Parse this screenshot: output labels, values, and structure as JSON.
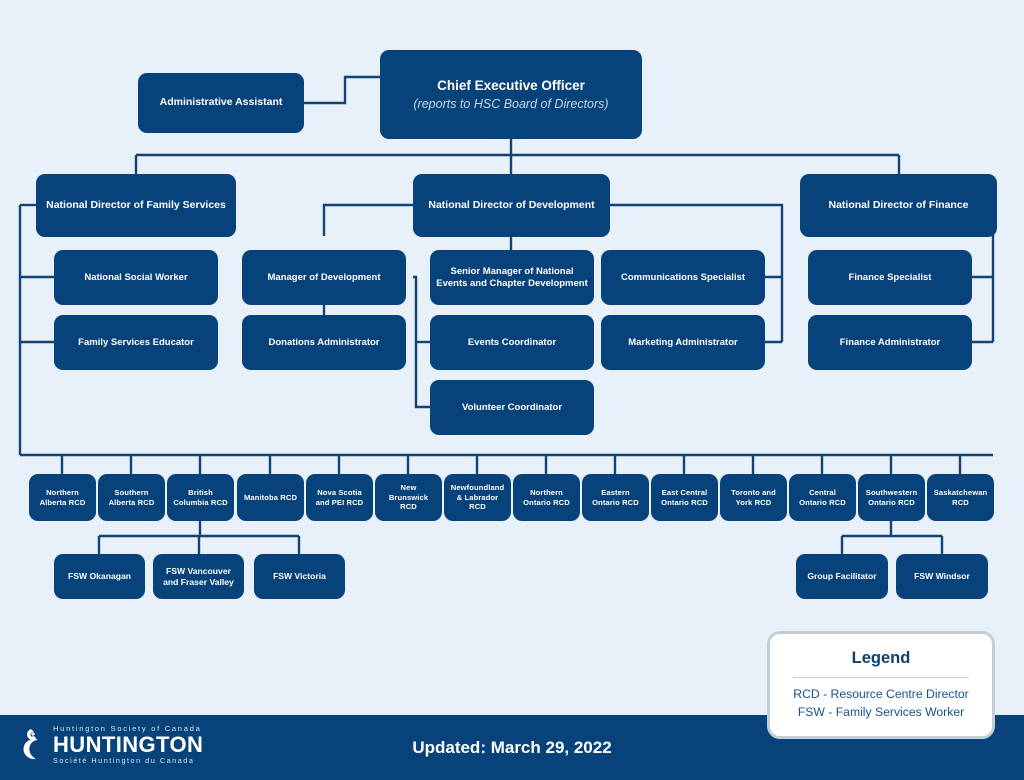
{
  "meta": {
    "background_color": "#e8f1f9",
    "node_color": "#07427a",
    "line_color": "#124372"
  },
  "chart_data": {
    "type": "diagram",
    "title": "Huntington Society of Canada Organizational Chart",
    "nodes": {
      "ceo": {
        "title": "Chief Executive Officer",
        "subtitle": "(reports to HSC Board of Directors)"
      },
      "admin_assistant": {
        "title": "Administrative Assistant"
      },
      "dir_family_services": {
        "title": "National Director of Family Services"
      },
      "dir_development": {
        "title": "National Director of Development"
      },
      "dir_finance": {
        "title": "National Director of Finance"
      },
      "national_social_worker": {
        "title": "National Social Worker"
      },
      "family_services_educator": {
        "title": "Family Services Educator"
      },
      "manager_of_development": {
        "title": "Manager of Development"
      },
      "donations_administrator": {
        "title": "Donations Administrator"
      },
      "senior_manager_events": {
        "title": "Senior Manager of National Events and Chapter Development"
      },
      "events_coordinator": {
        "title": "Events Coordinator"
      },
      "volunteer_coordinator": {
        "title": "Volunteer Coordinator"
      },
      "communications_specialist": {
        "title": "Communications Specialist"
      },
      "marketing_administrator": {
        "title": "Marketing Administrator"
      },
      "finance_specialist": {
        "title": "Finance Specialist"
      },
      "finance_administrator": {
        "title": "Finance Administrator"
      }
    },
    "rcd_row": [
      {
        "title": "Northern Alberta RCD"
      },
      {
        "title": "Southern Alberta RCD"
      },
      {
        "title": "British Columbia RCD"
      },
      {
        "title": "Manitoba RCD"
      },
      {
        "title": "Nova Scotia and PEI RCD"
      },
      {
        "title": "New Brunswick RCD"
      },
      {
        "title": "Newfoundland & Labrador RCD"
      },
      {
        "title": "Northern Ontario RCD"
      },
      {
        "title": "Eastern Ontario RCD"
      },
      {
        "title": "East Central Ontario RCD"
      },
      {
        "title": "Toronto and York RCD"
      },
      {
        "title": "Central Ontario RCD"
      },
      {
        "title": "Southwestern Ontario RCD"
      },
      {
        "title": "Saskatchewan RCD"
      }
    ],
    "fsw_row": [
      {
        "title": "FSW Okanagan",
        "parent": "British Columbia RCD"
      },
      {
        "title": "FSW Vancouver and Fraser Valley",
        "parent": "British Columbia RCD"
      },
      {
        "title": "FSW Victoria",
        "parent": "British Columbia RCD"
      },
      {
        "title": "Group Facilitator",
        "parent": "Southwestern Ontario RCD"
      },
      {
        "title": "FSW Windsor",
        "parent": "Southwestern Ontario RCD"
      }
    ],
    "edges": [
      [
        "ceo",
        "admin_assistant"
      ],
      [
        "ceo",
        "dir_family_services"
      ],
      [
        "ceo",
        "dir_development"
      ],
      [
        "ceo",
        "dir_finance"
      ],
      [
        "dir_family_services",
        "national_social_worker"
      ],
      [
        "dir_family_services",
        "family_services_educator"
      ],
      [
        "dir_family_services",
        "rcd_row"
      ],
      [
        "dir_development",
        "manager_of_development"
      ],
      [
        "dir_development",
        "donations_administrator"
      ],
      [
        "dir_development",
        "senior_manager_events"
      ],
      [
        "dir_development",
        "events_coordinator"
      ],
      [
        "dir_development",
        "volunteer_coordinator"
      ],
      [
        "dir_development",
        "communications_specialist"
      ],
      [
        "dir_development",
        "marketing_administrator"
      ],
      [
        "dir_finance",
        "finance_specialist"
      ],
      [
        "dir_finance",
        "finance_administrator"
      ],
      [
        "British Columbia RCD",
        "FSW Okanagan"
      ],
      [
        "British Columbia RCD",
        "FSW Vancouver and Fraser Valley"
      ],
      [
        "British Columbia RCD",
        "FSW Victoria"
      ],
      [
        "Southwestern Ontario RCD",
        "Group Facilitator"
      ],
      [
        "Southwestern Ontario RCD",
        "FSW Windsor"
      ]
    ]
  },
  "legend": {
    "title": "Legend",
    "line1": "RCD - Resource Centre Director",
    "line2": "FSW - Family Services Worker"
  },
  "footer": {
    "updated": "Updated: March 29, 2022",
    "logo_top": "Huntington Society of Canada",
    "logo_mid": "HUNTINGTON",
    "logo_bottom": "Société Huntington du Canada"
  }
}
